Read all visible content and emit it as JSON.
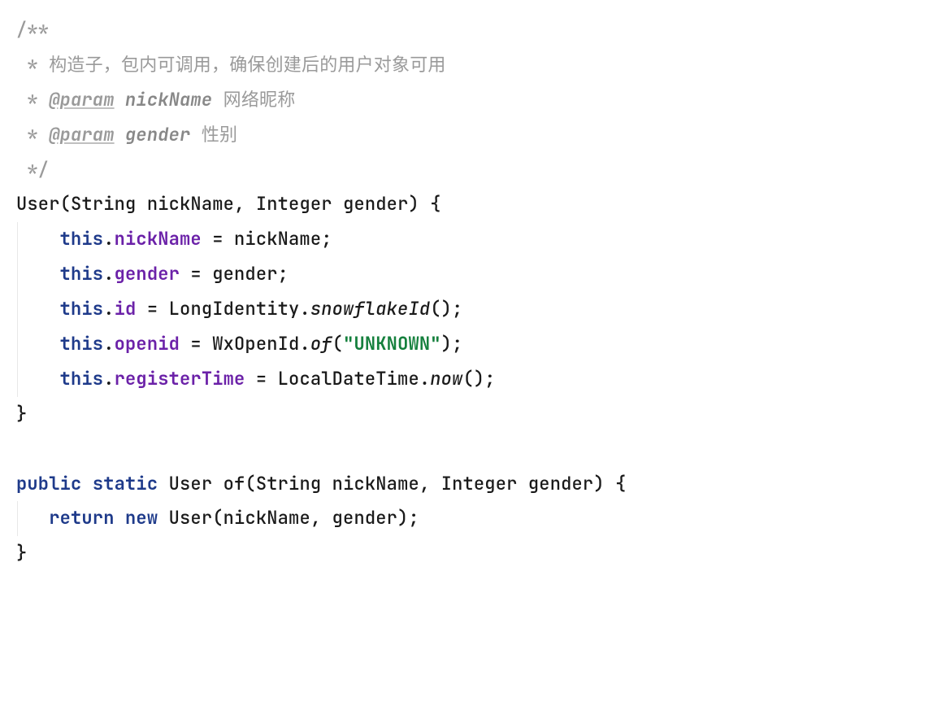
{
  "code": {
    "kw": {
      "this": "this",
      "public": "public",
      "static": "static",
      "return": "return",
      "new": "new"
    },
    "javadoc": {
      "open": "/**",
      "description": "构造子，包内可调用，确保创建后的用户对象可用",
      "params": [
        {
          "tag": "@param",
          "name": "nickName",
          "desc": "网络昵称"
        },
        {
          "tag": "@param",
          "name": "gender",
          "desc": "性别"
        }
      ],
      "close": " */"
    },
    "constructor": {
      "name": "User",
      "params": [
        {
          "type": "String",
          "name": "nickName"
        },
        {
          "type": "Integer",
          "name": "gender"
        }
      ],
      "body": [
        {
          "field": "nickName",
          "value": "nickName"
        },
        {
          "field": "gender",
          "value": "gender"
        },
        {
          "field": "id",
          "cls": "LongIdentity",
          "method": "snowflakeId"
        },
        {
          "field": "openid",
          "cls": "WxOpenId",
          "method": "of",
          "arg": "\"UNKNOWN\""
        },
        {
          "field": "registerTime",
          "cls": "LocalDateTime",
          "method": "now"
        }
      ]
    },
    "factory": {
      "returnType": "User",
      "name": "of",
      "params": [
        {
          "type": "String",
          "name": "nickName"
        },
        {
          "type": "Integer",
          "name": "gender"
        }
      ],
      "body": {
        "call": "User",
        "args": "nickName, gender"
      }
    }
  }
}
